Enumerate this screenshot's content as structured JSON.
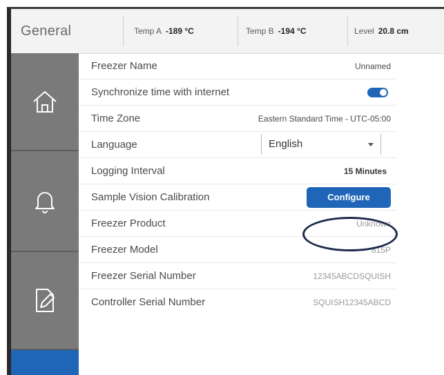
{
  "header": {
    "title": "General",
    "stats": [
      {
        "label": "Temp A",
        "value": "-189 °C"
      },
      {
        "label": "Temp B",
        "value": "-194 °C"
      },
      {
        "label": "Level",
        "value": "20.8 cm"
      }
    ]
  },
  "sidebar": {
    "items": [
      {
        "icon": "home-icon"
      },
      {
        "icon": "bell-icon"
      },
      {
        "icon": "edit-document-icon"
      }
    ],
    "active_color": "#1f66b8"
  },
  "settings": {
    "freezer_name": {
      "label": "Freezer Name",
      "value": "Unnamed"
    },
    "sync_time": {
      "label": "Synchronize time with internet",
      "enabled": true
    },
    "time_zone": {
      "label": "Time Zone",
      "value": "Eastern Standard Time - UTC-05:00"
    },
    "language": {
      "label": "Language",
      "value": "English"
    },
    "logging_interval": {
      "label": "Logging Interval",
      "value": "15 Minutes"
    },
    "sample_vision": {
      "label": "Sample Vision Calibration",
      "button": "Configure"
    },
    "freezer_product": {
      "label": "Freezer Product",
      "value": "Unknown"
    },
    "freezer_model": {
      "label": "Freezer Model",
      "value": "815P"
    },
    "freezer_serial": {
      "label": "Freezer Serial Number",
      "value": "12345ABCDSQUISH"
    },
    "controller_serial": {
      "label": "Controller Serial Number",
      "value": "SQUISH12345ABCD"
    }
  },
  "colors": {
    "accent": "#1f66b8",
    "sidebar": "#7a7a7a",
    "highlight_ring": "#1b2a4a"
  }
}
